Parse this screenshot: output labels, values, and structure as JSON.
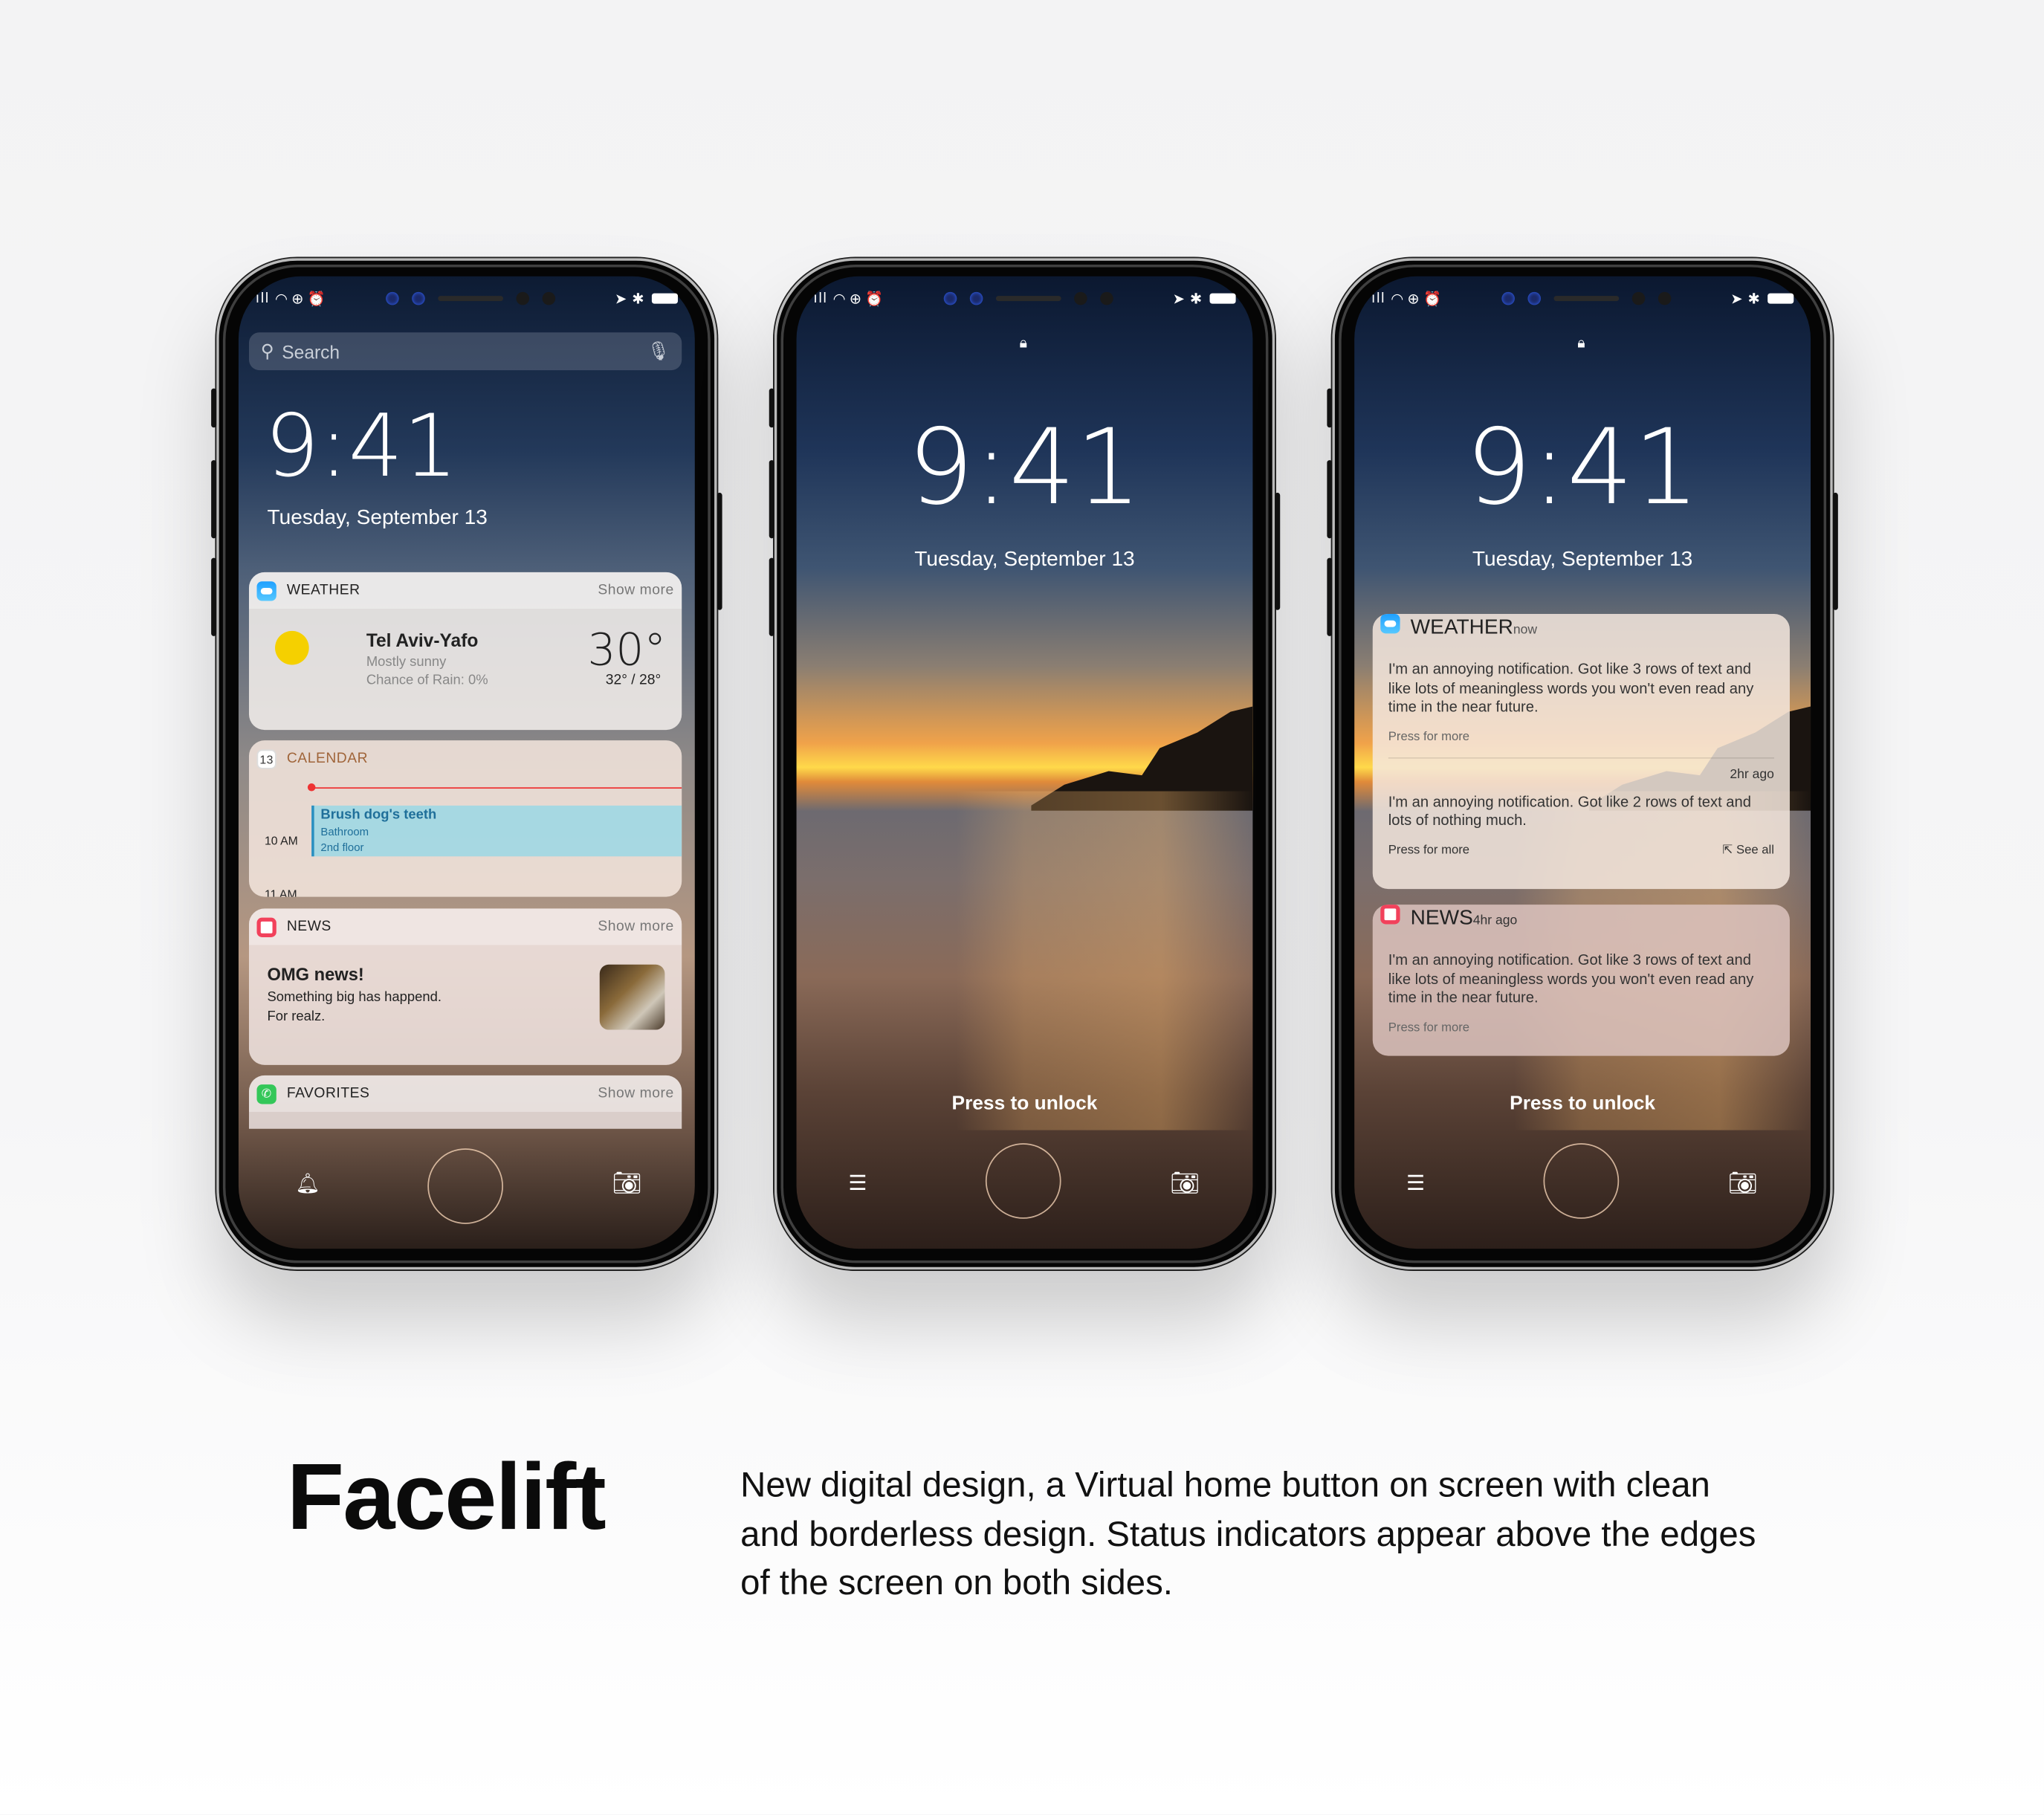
{
  "status": {
    "signal": "ıll",
    "wifi": "wifi-icon",
    "location": "➤",
    "bluetooth": "✱"
  },
  "lock_screen": {
    "time": "9:41",
    "date": "Tuesday, September 13",
    "press_to_unlock": "Press to unlock"
  },
  "phone1": {
    "search_placeholder": "Search",
    "weather": {
      "title": "WEATHER",
      "show_more": "Show more",
      "city": "Tel Aviv-Yafo",
      "condition": "Mostly sunny",
      "rain": "Chance of Rain: 0%",
      "temp": "30°",
      "range": "32° / 28°"
    },
    "calendar": {
      "icon_day": "13",
      "title": "CALENDAR",
      "event": "Brush dog's teeth",
      "location1": "Bathroom",
      "location2": "2nd floor",
      "time1": "10 AM",
      "time2": "11 AM"
    },
    "news": {
      "title": "NEWS",
      "show_more": "Show more",
      "headline": "OMG news!",
      "line1": "Something big has happend.",
      "line2": "For realz."
    },
    "favorites": {
      "title": "FAVORITES",
      "show_more": "Show more"
    }
  },
  "phone3": {
    "weather_notif": {
      "title": "WEATHER",
      "time": "now",
      "text": "I'm an annoying notification. Got like 3 rows of text and like lots of meaningless words you won't even read any time in the near future.",
      "more": "Press for more",
      "time2": "2hr ago",
      "text2": "I'm an annoying notification. Got like 2 rows of text and lots of nothing much.",
      "more2": "Press for more",
      "see_all": "See all"
    },
    "news_notif": {
      "title": "NEWS",
      "time": "4hr ago",
      "text": "I'm an annoying notification. Got like 3 rows of text and like lots of meaningless words you won't even read any time in the near future.",
      "more": "Press for more"
    }
  },
  "caption": {
    "title": "Facelift",
    "description": "New digital design, a Virtual home button on screen with clean and borderless design. Status indicators appear above the edges of the screen on both sides."
  }
}
